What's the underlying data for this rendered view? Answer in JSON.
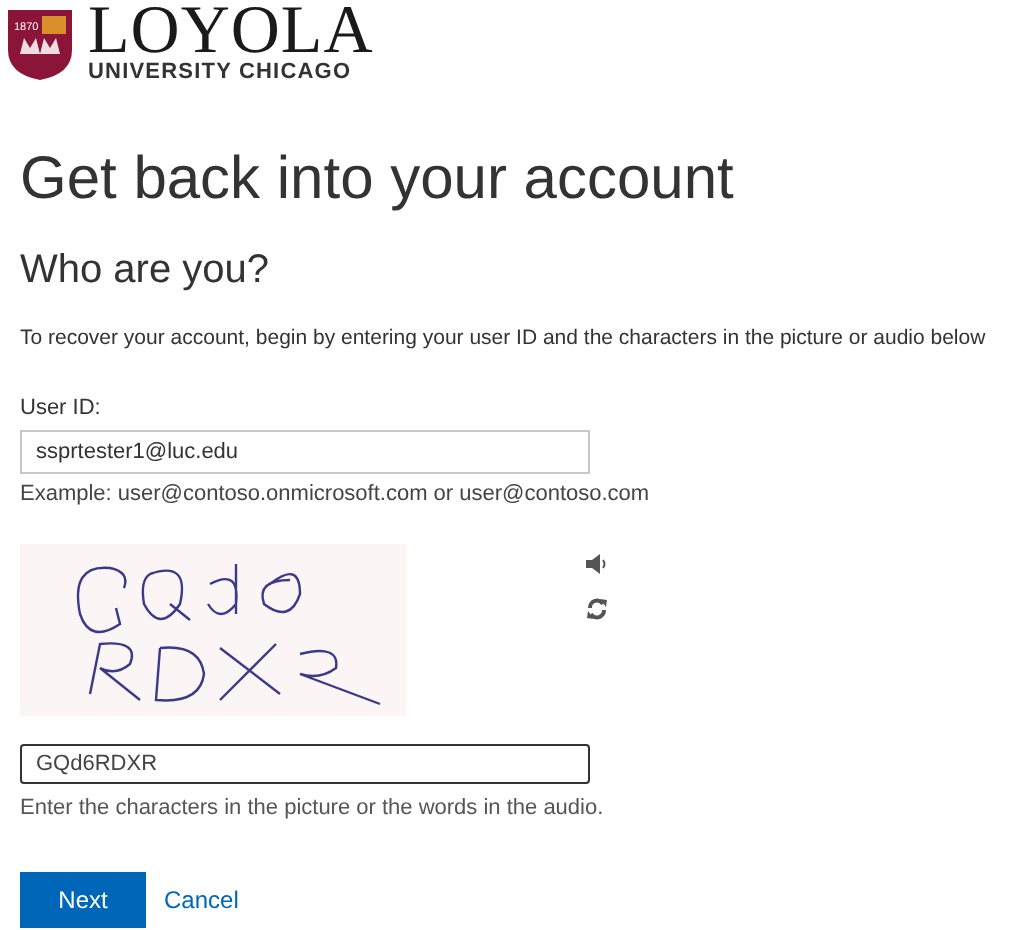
{
  "logo": {
    "shield_year": "1870",
    "name": "LOYOLA",
    "subtitle": "UNIVERSITY CHICAGO"
  },
  "title": "Get back into your account",
  "subtitle": "Who are you?",
  "intro": "To recover your account, begin by entering your user ID and the characters in the picture or audio below",
  "user_id": {
    "label": "User ID:",
    "value": "ssprtester1@luc.edu",
    "hint": "Example: user@contoso.onmicrosoft.com or user@contoso.com"
  },
  "captcha": {
    "value": "GQd6RDXR",
    "focused": true,
    "hint": "Enter the characters in the picture or the words in the audio."
  },
  "buttons": [
    {
      "label": "Next",
      "kind": "primary"
    },
    {
      "label": "Cancel",
      "kind": "link"
    }
  ]
}
